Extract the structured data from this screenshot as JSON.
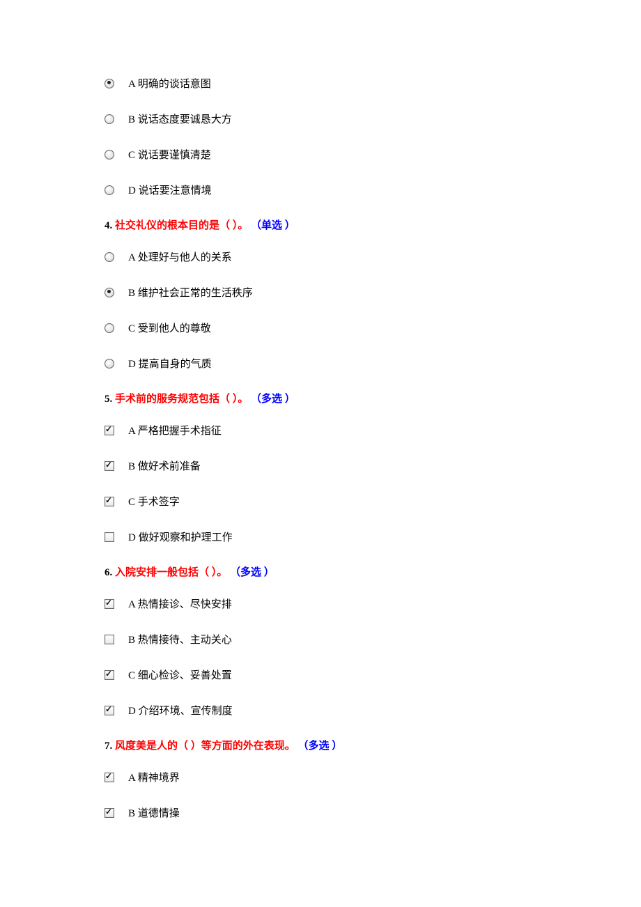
{
  "groups": [
    {
      "options": [
        {
          "kind": "radio",
          "checked": true,
          "label": "A 明确的谈话意图"
        },
        {
          "kind": "radio",
          "checked": false,
          "label": "B 说话态度要诚恳大方"
        },
        {
          "kind": "radio",
          "checked": false,
          "label": "C 说话要谨慎清楚"
        },
        {
          "kind": "radio",
          "checked": false,
          "label": "D 说话要注意情境"
        }
      ]
    },
    {
      "number": "4.",
      "text": "社交礼仪的根本目的是（ ）。",
      "type": "（单选 ）",
      "options": [
        {
          "kind": "radio",
          "checked": false,
          "label": "A 处理好与他人的关系"
        },
        {
          "kind": "radio",
          "checked": true,
          "label": "B 维护社会正常的生活秩序"
        },
        {
          "kind": "radio",
          "checked": false,
          "label": "C 受到他人的尊敬"
        },
        {
          "kind": "radio",
          "checked": false,
          "label": "D 提高自身的气质"
        }
      ]
    },
    {
      "number": "5.",
      "text": "手术前的服务规范包括（ ）。",
      "type": "（多选 ）",
      "options": [
        {
          "kind": "checkbox",
          "checked": true,
          "label": "A 严格把握手术指征"
        },
        {
          "kind": "checkbox",
          "checked": true,
          "label": "B 做好术前准备"
        },
        {
          "kind": "checkbox",
          "checked": true,
          "label": "C 手术签字"
        },
        {
          "kind": "checkbox",
          "checked": false,
          "label": "D 做好观察和护理工作"
        }
      ]
    },
    {
      "number": "6.",
      "text": "入院安排一般包括（ ）。",
      "type": "（多选 ）",
      "options": [
        {
          "kind": "checkbox",
          "checked": true,
          "label": "A 热情接诊、尽快安排"
        },
        {
          "kind": "checkbox",
          "checked": false,
          "label": "B 热情接待、主动关心"
        },
        {
          "kind": "checkbox",
          "checked": true,
          "label": "C 细心检诊、妥善处置"
        },
        {
          "kind": "checkbox",
          "checked": true,
          "label": "D 介绍环境、宣传制度"
        }
      ]
    },
    {
      "number": "7.",
      "text": "风度美是人的（ ）等方面的外在表现。",
      "type": "（多选 ）",
      "options": [
        {
          "kind": "checkbox",
          "checked": true,
          "label": "A 精神境界"
        },
        {
          "kind": "checkbox",
          "checked": true,
          "label": "B 道德情操"
        }
      ]
    }
  ]
}
